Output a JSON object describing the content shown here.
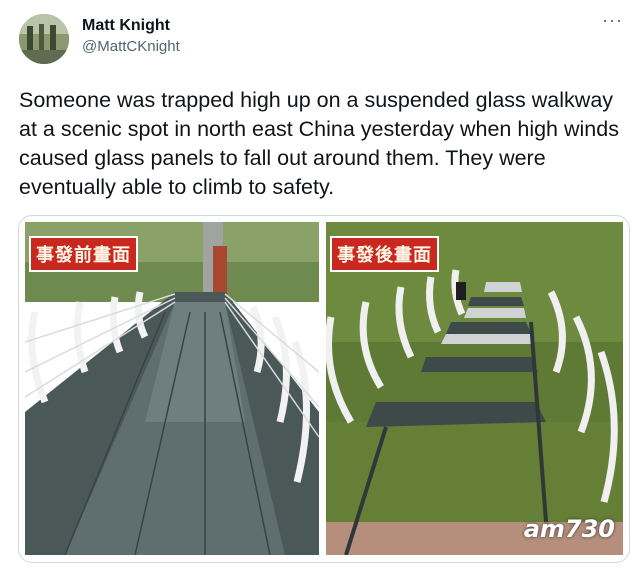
{
  "tweet": {
    "display_name": "Matt Knight",
    "handle": "@MattCKnight",
    "more_icon": "···",
    "text": "Someone was trapped high up on a suspended glass walkway at a scenic spot in north east China yesterday when high winds caused glass panels to fall out around them. They were eventually able to climb to safety."
  },
  "media": {
    "left_label": "事發前畫面",
    "right_label": "事發後畫面",
    "watermark": "am730"
  }
}
